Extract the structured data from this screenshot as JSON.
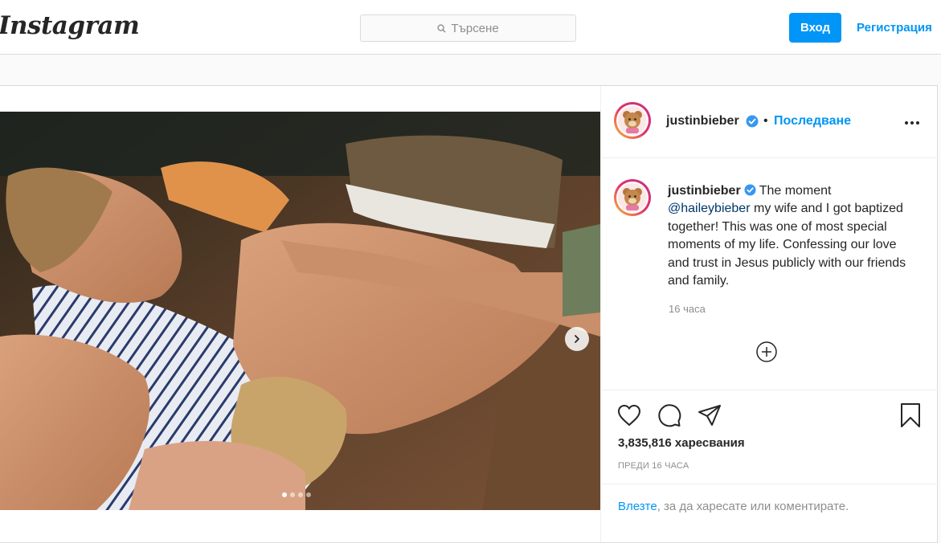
{
  "header": {
    "logo": "Instagram",
    "search_placeholder": "Търсене",
    "login_label": "Вход",
    "register_label": "Регистрация"
  },
  "post": {
    "username": "justinbieber",
    "follow_separator": "•",
    "follow_label": "Последване",
    "caption": {
      "username": "justinbieber",
      "text_before": "The moment",
      "mention": "@haileybieber",
      "text_after": "my wife and I got baptized together! This was one of most special moments of my life. Confessing our love and trust in Jesus publicly with our friends and family."
    },
    "caption_time": "16 часа",
    "likes": "3,835,816 харесвания",
    "posted_ago": "ПРЕДИ 16 ЧАСА",
    "login_hint": {
      "link": "Влезте",
      "text": ", за да харесате или коментирате."
    },
    "carousel": {
      "count": 4,
      "active": 1
    }
  },
  "colors": {
    "accent": "#0095f6",
    "verified": "#3897f0",
    "border": "#dbdbdb"
  },
  "icons": [
    "search-icon",
    "verified-badge-icon",
    "more-options-icon",
    "chevron-right-icon",
    "add-comment-icon",
    "heart-icon",
    "comment-icon",
    "share-icon",
    "bookmark-icon"
  ]
}
